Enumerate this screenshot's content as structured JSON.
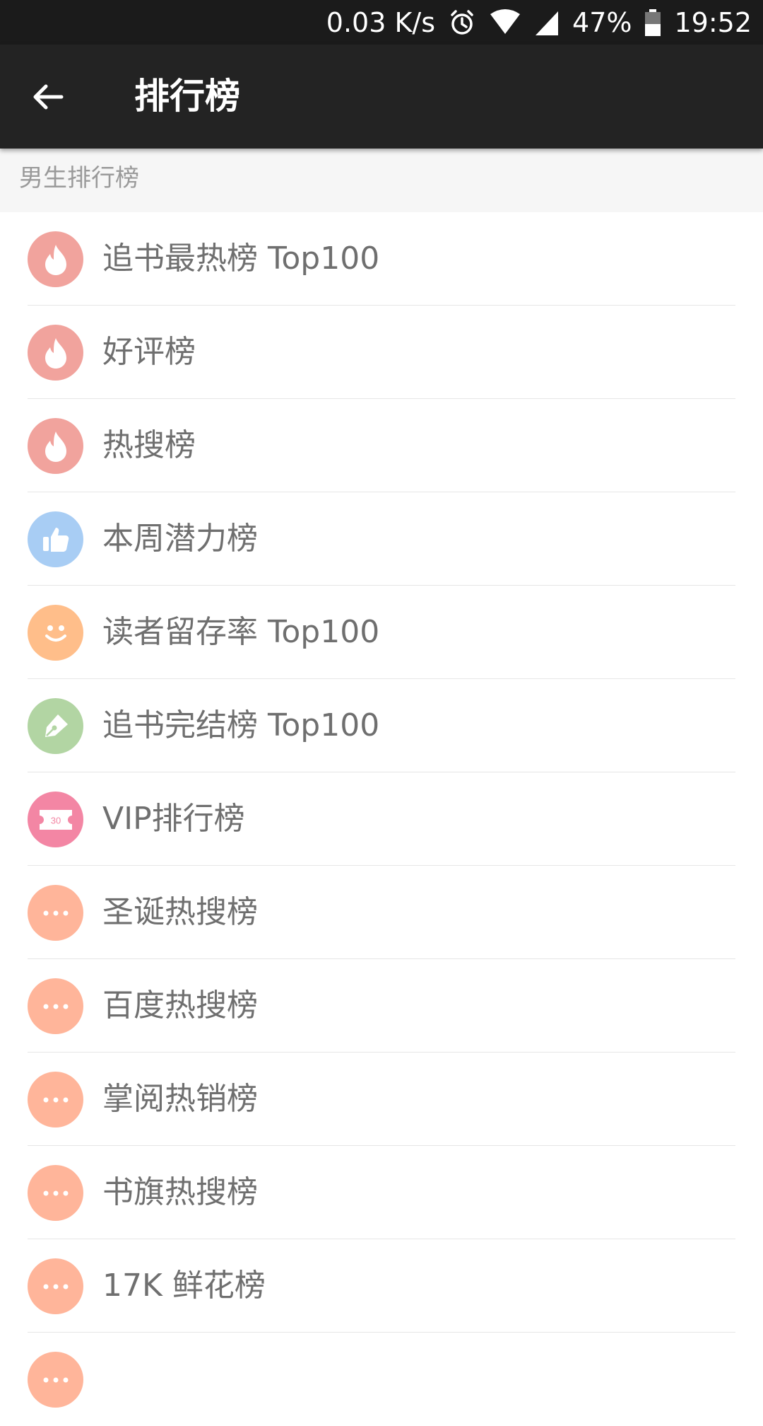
{
  "status_bar": {
    "net_speed": "0.03 K/s",
    "battery": "47%",
    "time": "19:52",
    "icons": [
      "alarm-icon",
      "wifi-icon",
      "signal-icon",
      "battery-icon"
    ]
  },
  "app_bar": {
    "title": "排行榜",
    "back_icon": "arrow-left-icon"
  },
  "section": {
    "title": "男生排行榜"
  },
  "colors": {
    "status_bg": "#1b1b1b",
    "appbar_bg": "#232323",
    "section_bg": "#f6f6f6",
    "flame": "#f1a39d",
    "thumb": "#a8cdf4",
    "smile": "#ffbe8a",
    "pen": "#b2d5a3",
    "ticket": "#f386a4",
    "dots": "#ffb59a"
  },
  "items": [
    {
      "label": "追书最热榜 Top100",
      "icon": "flame-icon"
    },
    {
      "label": "好评榜",
      "icon": "flame-icon"
    },
    {
      "label": "热搜榜",
      "icon": "flame-icon"
    },
    {
      "label": "本周潜力榜",
      "icon": "thumbs-up-icon"
    },
    {
      "label": "读者留存率 Top100",
      "icon": "smile-icon"
    },
    {
      "label": "追书完结榜 Top100",
      "icon": "pen-icon"
    },
    {
      "label": "VIP排行榜",
      "icon": "ticket-icon",
      "icon_text": "30"
    },
    {
      "label": "圣诞热搜榜",
      "icon": "more-dots-icon"
    },
    {
      "label": "百度热搜榜",
      "icon": "more-dots-icon"
    },
    {
      "label": "掌阅热销榜",
      "icon": "more-dots-icon"
    },
    {
      "label": "书旗热搜榜",
      "icon": "more-dots-icon"
    },
    {
      "label": "17K 鲜花榜",
      "icon": "more-dots-icon"
    },
    {
      "label": "",
      "icon": "more-dots-icon"
    }
  ]
}
